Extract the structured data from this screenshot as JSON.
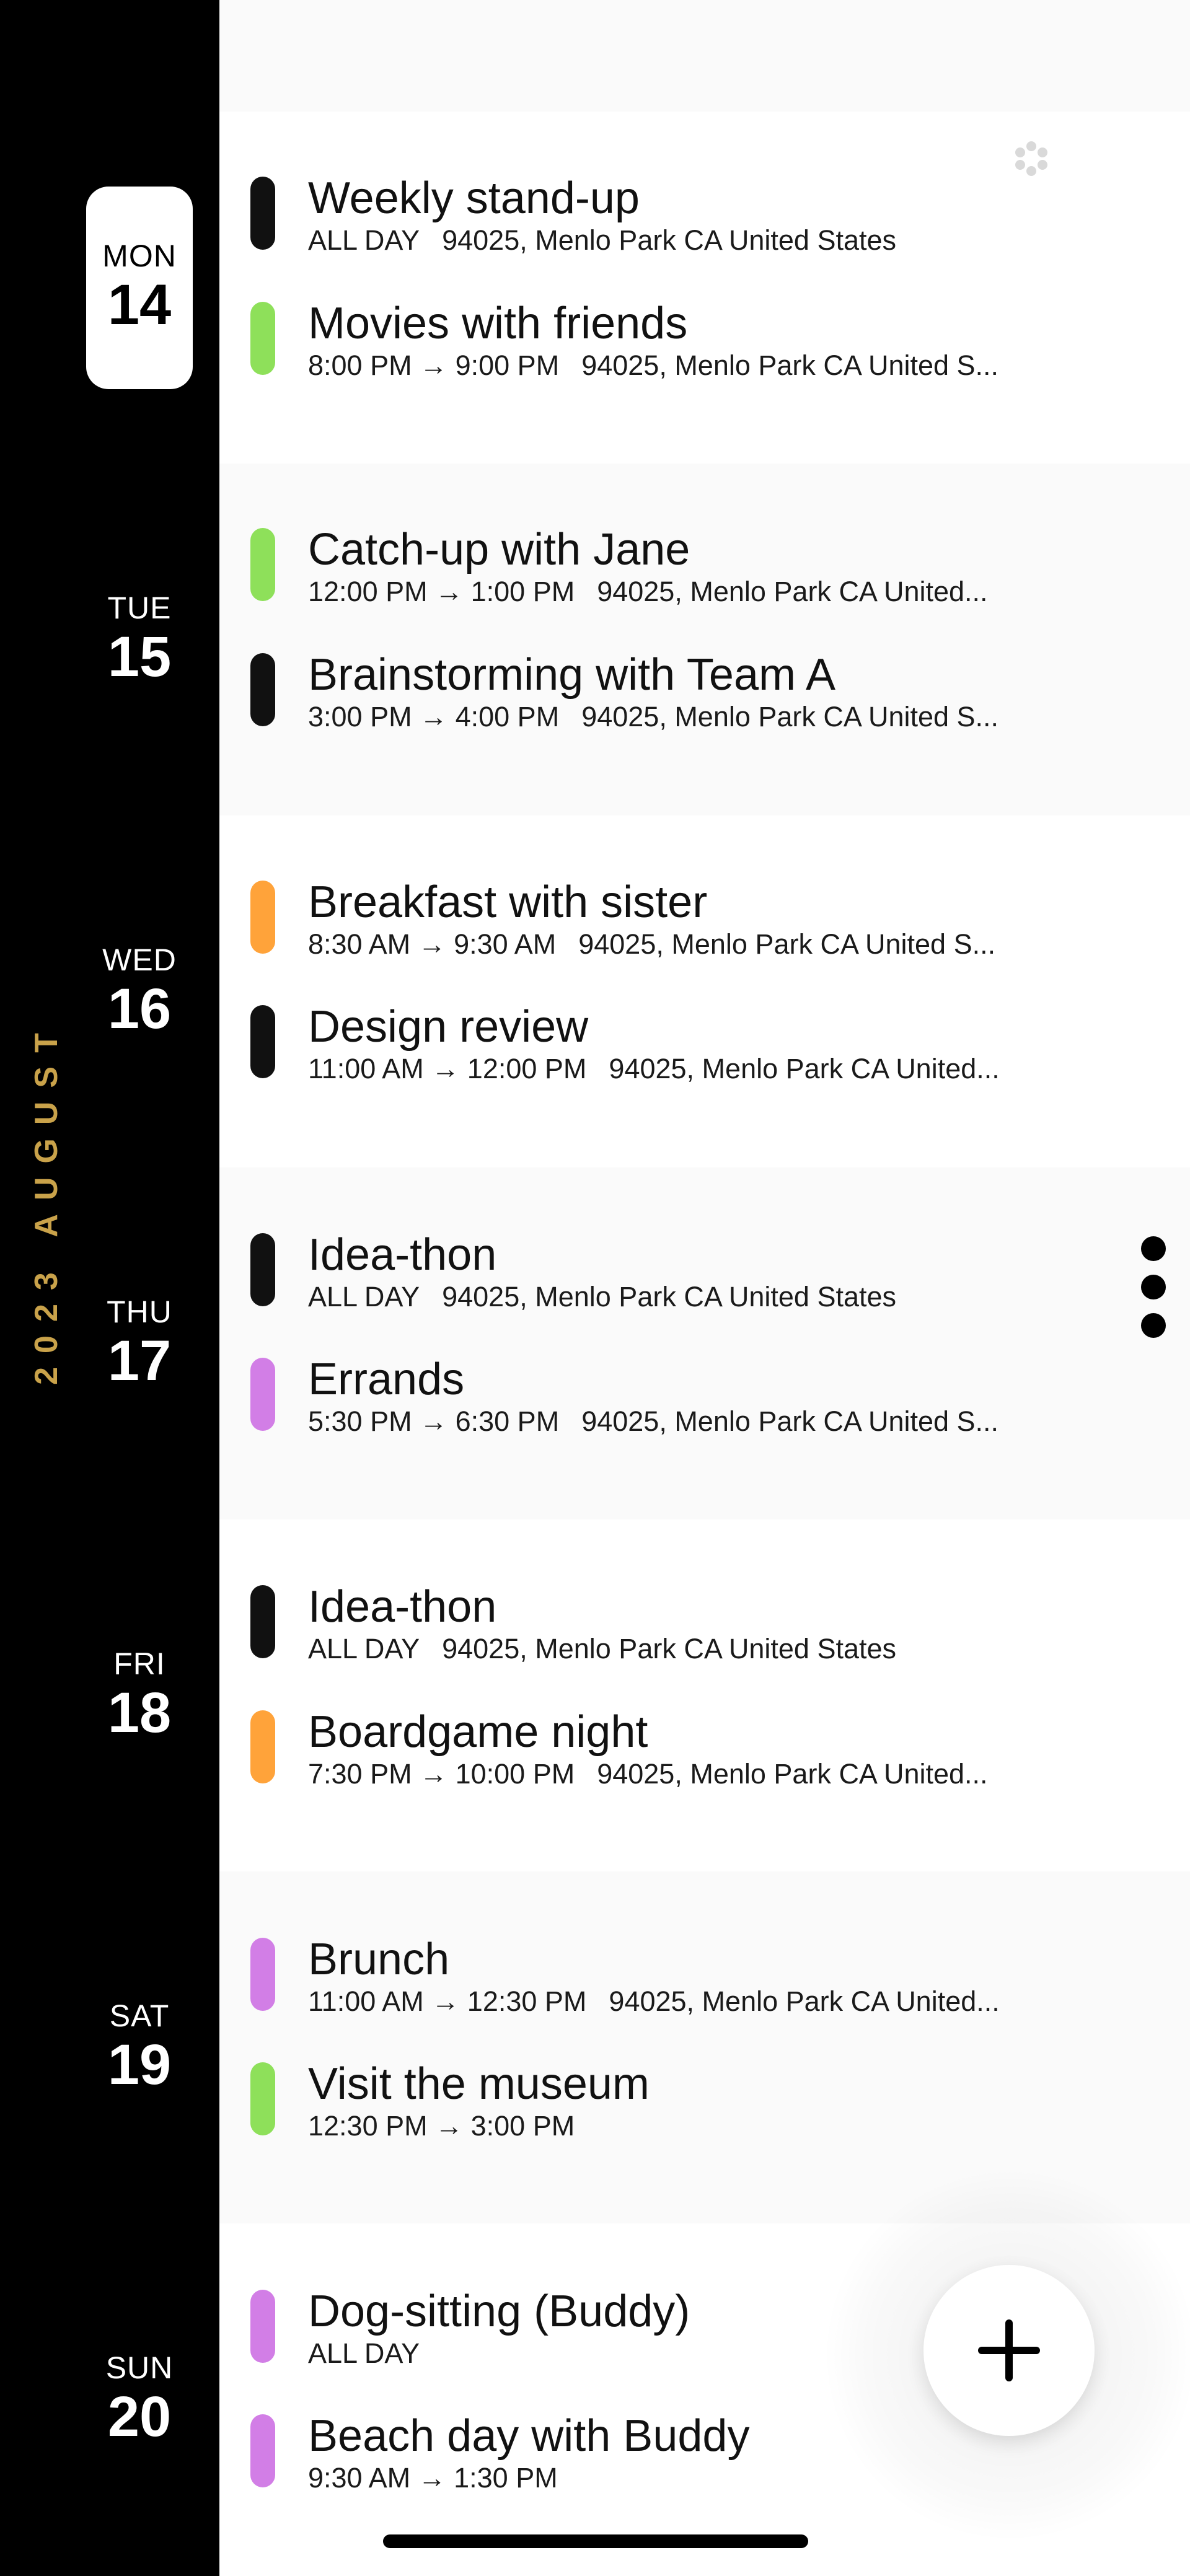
{
  "calendar": {
    "month_label": "2023 AUGUST",
    "days": [
      {
        "dow": "MON",
        "date": "14",
        "selected": true,
        "events": [
          {
            "title": "Weekly stand-up",
            "time": "ALL DAY",
            "location": "94025, Menlo Park CA United States",
            "color": "#111111"
          },
          {
            "title": "Movies with friends",
            "time": "8:00 PM → 9:00 PM",
            "location": "94025, Menlo Park CA United S...",
            "color": "#8ee05a"
          }
        ]
      },
      {
        "dow": "TUE",
        "date": "15",
        "selected": false,
        "events": [
          {
            "title": "Catch-up with Jane",
            "time": "12:00 PM → 1:00 PM",
            "location": "94025, Menlo Park CA United...",
            "color": "#8ee05a"
          },
          {
            "title": "Brainstorming with Team A",
            "time": "3:00 PM → 4:00 PM",
            "location": "94025, Menlo Park CA United S...",
            "color": "#111111"
          }
        ]
      },
      {
        "dow": "WED",
        "date": "16",
        "selected": false,
        "events": [
          {
            "title": "Breakfast with sister",
            "time": "8:30 AM → 9:30 AM",
            "location": "94025, Menlo Park CA United S...",
            "color": "#ffa33a"
          },
          {
            "title": "Design review",
            "time": "11:00 AM → 12:00 PM",
            "location": "94025, Menlo Park CA United...",
            "color": "#111111"
          }
        ]
      },
      {
        "dow": "THU",
        "date": "17",
        "selected": false,
        "events": [
          {
            "title": "Idea-thon",
            "time": "ALL DAY",
            "location": "94025, Menlo Park CA United States",
            "color": "#111111"
          },
          {
            "title": "Errands",
            "time": "5:30 PM → 6:30 PM",
            "location": "94025, Menlo Park CA United S...",
            "color": "#d27ee6"
          }
        ]
      },
      {
        "dow": "FRI",
        "date": "18",
        "selected": false,
        "events": [
          {
            "title": "Idea-thon",
            "time": "ALL DAY",
            "location": "94025, Menlo Park CA United States",
            "color": "#111111"
          },
          {
            "title": "Boardgame night",
            "time": "7:30 PM → 10:00 PM",
            "location": "94025, Menlo Park CA United...",
            "color": "#ffa33a"
          }
        ]
      },
      {
        "dow": "SAT",
        "date": "19",
        "selected": false,
        "events": [
          {
            "title": "Brunch",
            "time": "11:00 AM → 12:30 PM",
            "location": "94025, Menlo Park CA United...",
            "color": "#d27ee6"
          },
          {
            "title": "Visit the museum",
            "time": "12:30 PM → 3:00 PM",
            "location": "",
            "color": "#8ee05a"
          }
        ]
      },
      {
        "dow": "SUN",
        "date": "20",
        "selected": false,
        "events": [
          {
            "title": "Dog-sitting (Buddy)",
            "time": "ALL DAY",
            "location": "",
            "color": "#d27ee6"
          },
          {
            "title": "Beach day with Buddy",
            "time": "9:30 AM → 1:30 PM",
            "location": "",
            "color": "#d27ee6"
          }
        ]
      }
    ]
  },
  "icons": {
    "fab": "plus-icon",
    "more": "more-vertical-icon",
    "loading": "loading-spinner-icon"
  },
  "colors": {
    "rail": "#000000",
    "month_accent": "#c9a24a",
    "green": "#8ee05a",
    "orange": "#ffa33a",
    "purple": "#d27ee6",
    "black": "#111111"
  }
}
